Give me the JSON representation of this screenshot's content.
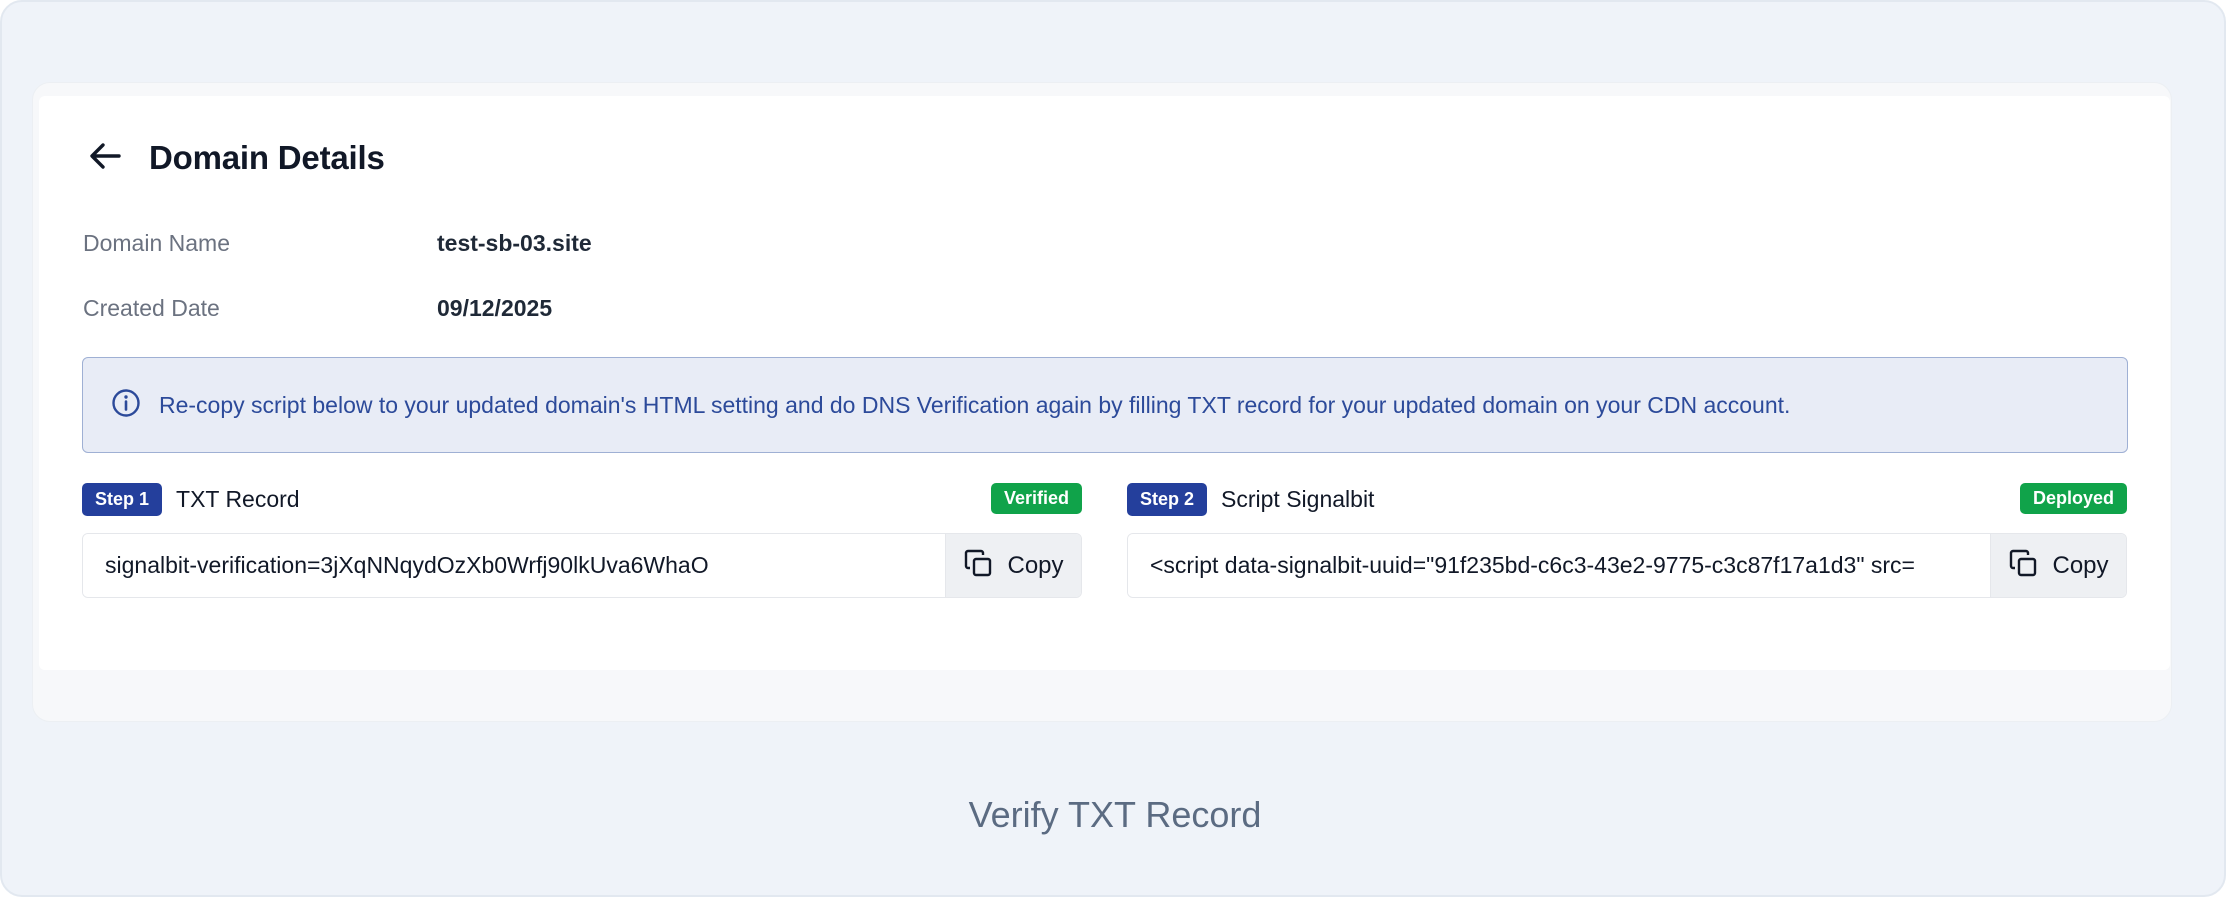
{
  "header": {
    "title": "Domain Details",
    "back_icon": "arrow-left-icon"
  },
  "details": {
    "domain_name_label": "Domain Name",
    "domain_name_value": "test-sb-03.site",
    "created_date_label": "Created Date",
    "created_date_value": "09/12/2025"
  },
  "alert": {
    "icon": "info-icon",
    "text": "Re-copy script below to your updated domain's HTML setting and do DNS Verification again by filling TXT record for your updated domain on your CDN account."
  },
  "steps": [
    {
      "tag": "Step 1",
      "title": "TXT Record",
      "status": "Verified",
      "value": "signalbit-verification=3jXqNNqydOzXb0Wrfj90lkUva6WhaO",
      "copy_label": "Copy"
    },
    {
      "tag": "Step 2",
      "title": "Script Signalbit",
      "status": "Deployed",
      "value": "<script data-signalbit-uuid=\"91f235bd-c6c3-43e2-9775-c3c87f17a1d3\" src=",
      "copy_label": "Copy"
    }
  ],
  "caption": "Verify TXT Record",
  "colors": {
    "accent": "#243f9c",
    "success": "#10a34a",
    "alert_bg": "#e8ecf6",
    "alert_text": "#2c4a9a"
  }
}
